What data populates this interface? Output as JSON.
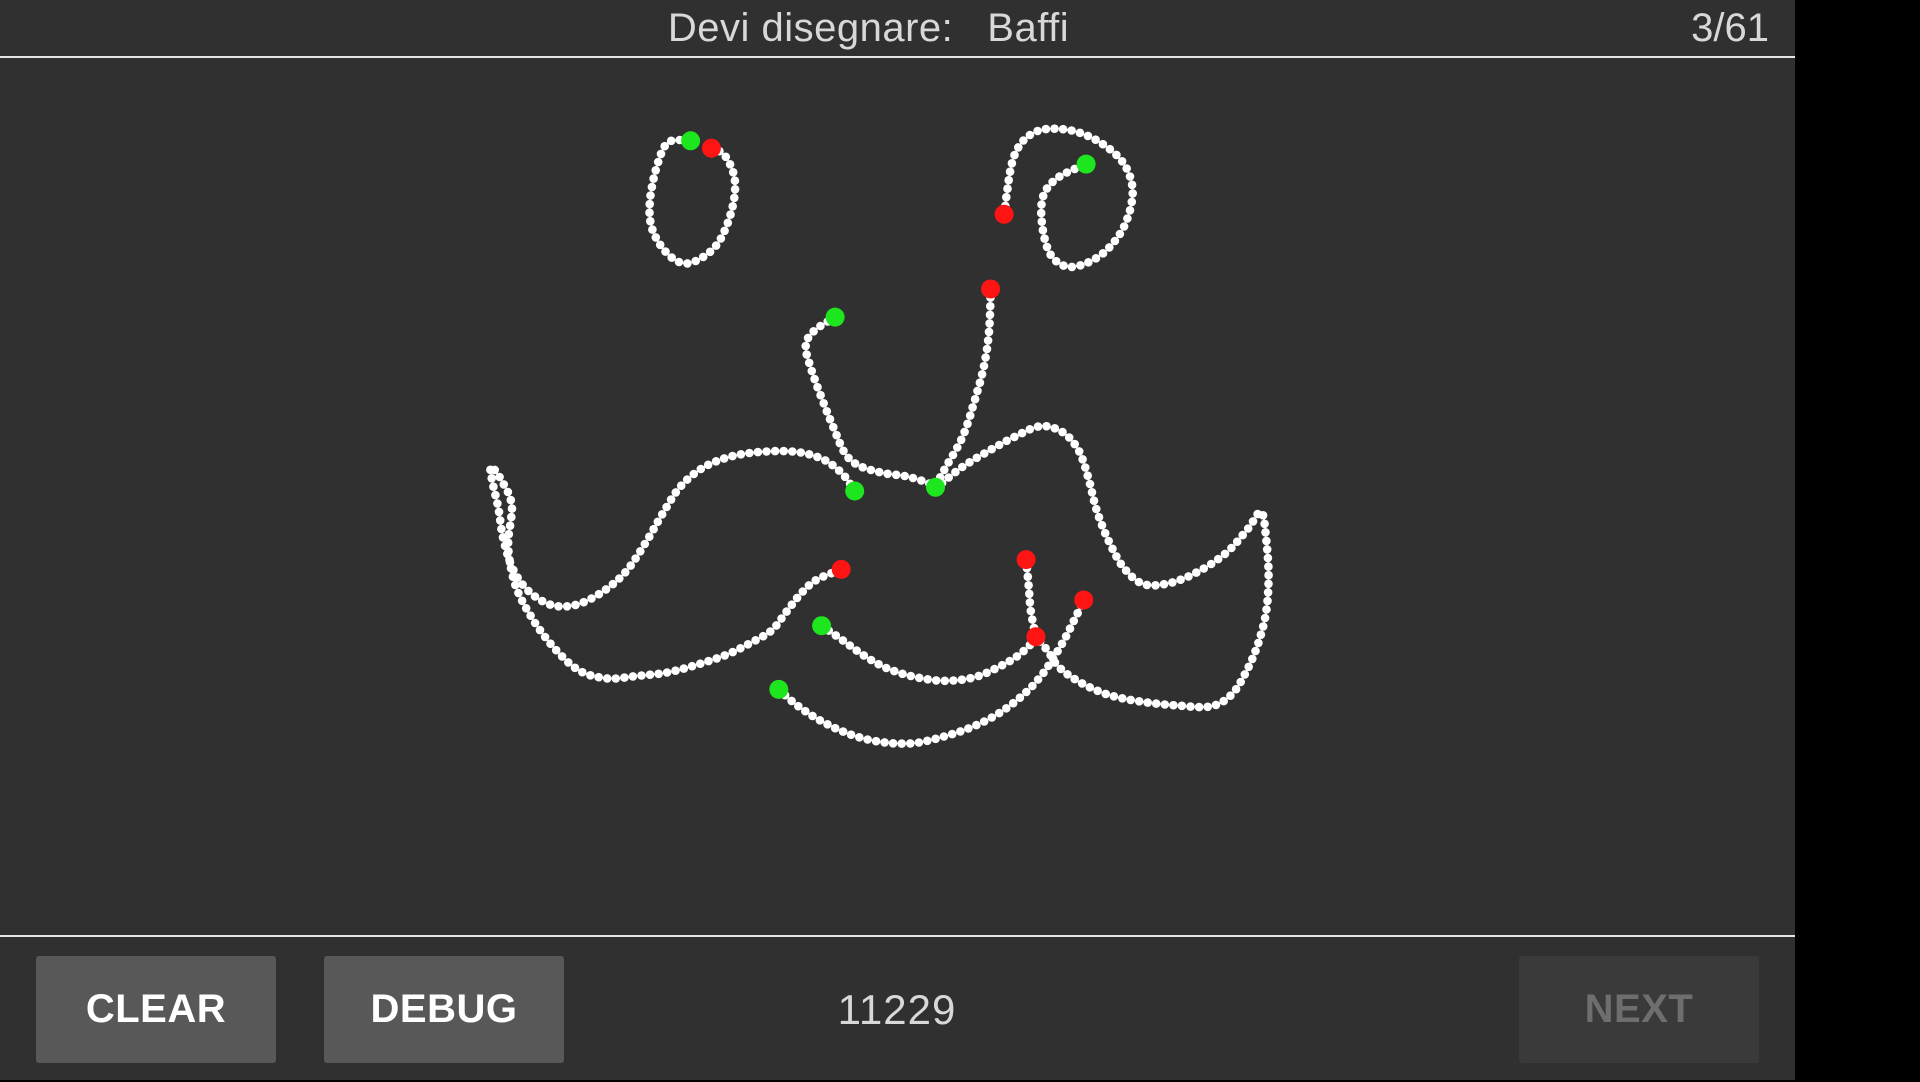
{
  "header": {
    "prompt_label": "Devi disegnare:",
    "target_word": "Baffi",
    "counter": "3/61"
  },
  "footer": {
    "clear_label": "CLEAR",
    "debug_label": "DEBUG",
    "score": "11229",
    "next_label": "NEXT",
    "next_enabled": false
  },
  "colors": {
    "background": "#303030",
    "stroke_point": "#ffffff",
    "stroke_start": "#1ee61e",
    "stroke_end": "#ff1414",
    "divider": "#e6e6e6"
  },
  "icons": {
    "stroke_start_marker": "green-dot",
    "stroke_end_marker": "red-dot",
    "stroke_point_marker": "white-dot"
  }
}
